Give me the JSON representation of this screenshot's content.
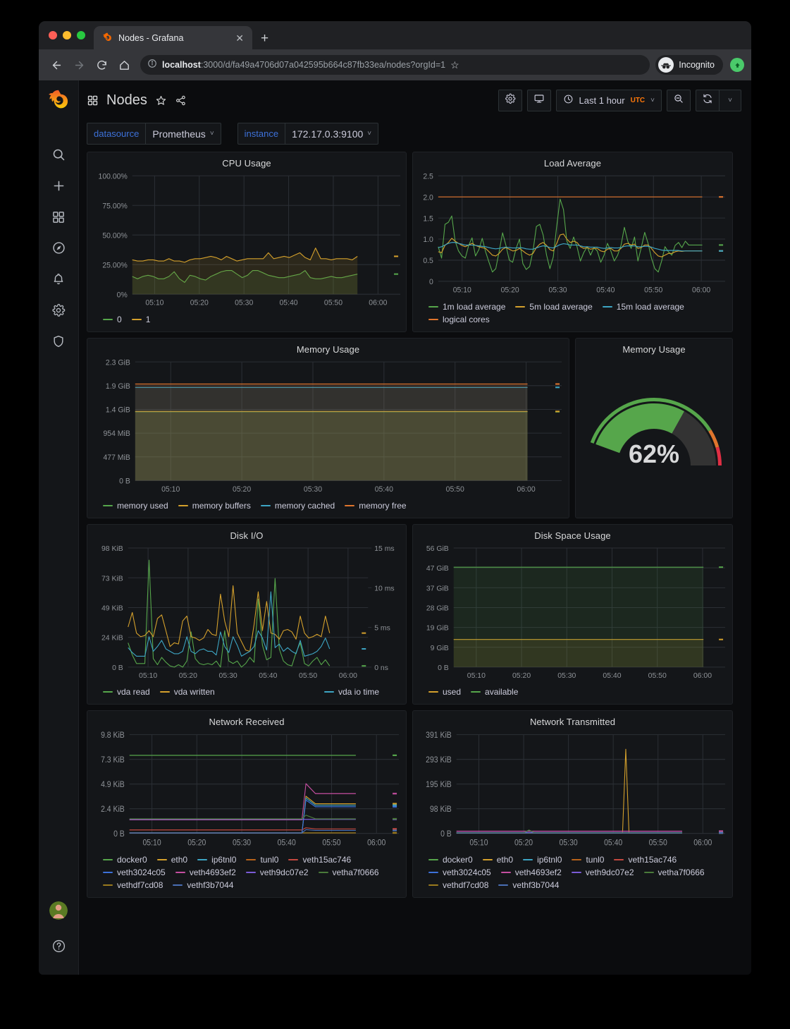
{
  "browser": {
    "tab": {
      "title": "Nodes - Grafana",
      "favicon": "grafana-logo-icon",
      "close": "✕"
    },
    "newtab_label": "+",
    "nav": {
      "back": "←",
      "forward": "→",
      "reload": "↻",
      "home": "⌂"
    },
    "omnibox": {
      "info_icon": "info-circle-icon",
      "url_bold": "localhost",
      "url_rest": ":3000/d/fa49a4706d07a042595b664c87fb33ea/nodes?orgId=1",
      "star_icon": "☆"
    },
    "profile": {
      "label": "Incognito",
      "icon": "incognito-icon"
    },
    "update_icon": "update-arrow-icon"
  },
  "sidenav": {
    "logo": "grafana-logo-icon",
    "items": [
      {
        "name": "search",
        "icon": "search-icon"
      },
      {
        "name": "create",
        "icon": "plus-icon"
      },
      {
        "name": "dashboards",
        "icon": "apps-grid-icon"
      },
      {
        "name": "explore",
        "icon": "compass-icon"
      },
      {
        "name": "alerting",
        "icon": "bell-icon"
      },
      {
        "name": "configuration",
        "icon": "gear-icon"
      },
      {
        "name": "server-admin",
        "icon": "shield-icon"
      }
    ],
    "avatar": "user-avatar",
    "help": "?"
  },
  "header": {
    "dashboards_icon": "apps-grid-icon",
    "title": "Nodes",
    "star_icon": "☆",
    "share_icon": "share-icon",
    "settings_icon": "gear-icon",
    "tv_icon": "tv-monitor-icon",
    "time_range": "Last 1 hour",
    "timezone": "UTC",
    "clock_icon": "clock-icon",
    "time_caret": "˅",
    "zoom_out_icon": "zoom-out-icon",
    "refresh_icon": "refresh-icon",
    "refresh_caret": "˅"
  },
  "variables": [
    {
      "label": "datasource",
      "value": "Prometheus",
      "caret": "˅"
    },
    {
      "label": "instance",
      "value": "172.17.0.3:9100",
      "caret": "˅"
    }
  ],
  "chart_data": [
    {
      "id": "cpu",
      "type": "area",
      "title": "CPU Usage",
      "xlabel": "",
      "ylabel": "",
      "ylim": [
        0,
        100
      ],
      "yticks": [
        "0%",
        "25.00%",
        "50.00%",
        "75.00%",
        "100.00%"
      ],
      "xticks": [
        "05:10",
        "05:20",
        "05:30",
        "05:40",
        "05:50",
        "06:00"
      ],
      "grid": true,
      "legend_position": "bottom",
      "series": [
        {
          "name": "0",
          "color": "#56a64b",
          "values": [
            15,
            13,
            15,
            16,
            15,
            13,
            13,
            15,
            19,
            13,
            10,
            16,
            15,
            13,
            12,
            15,
            17,
            19,
            20,
            20,
            17,
            14,
            16,
            20,
            20,
            18,
            16,
            15,
            14,
            14,
            15,
            16,
            17,
            20,
            14,
            13,
            13,
            14,
            15,
            14,
            14,
            15,
            16,
            17
          ]
        },
        {
          "name": "1",
          "color": "#d4a02c",
          "values": [
            29,
            28,
            28,
            29,
            29,
            28,
            28,
            30,
            28,
            28,
            27,
            29,
            30,
            30,
            31,
            32,
            31,
            29,
            32,
            30,
            28,
            29,
            30,
            30,
            30,
            30,
            35,
            30,
            31,
            32,
            31,
            33,
            35,
            31,
            29,
            39,
            30,
            30,
            29,
            30,
            30,
            30,
            29,
            32
          ]
        }
      ]
    },
    {
      "id": "load",
      "type": "line",
      "title": "Load Average",
      "ylim": [
        0,
        2.5
      ],
      "yticks": [
        "0",
        "0.5",
        "1.0",
        "1.5",
        "2.0",
        "2.5"
      ],
      "xticks": [
        "05:10",
        "05:20",
        "05:30",
        "05:40",
        "05:50",
        "06:00"
      ],
      "grid": true,
      "legend_position": "bottom",
      "series": [
        {
          "name": "1m load average",
          "color": "#56a64b",
          "values": [
            0.82,
            0.55,
            1.35,
            1.4,
            1.55,
            0.95,
            0.72,
            0.6,
            0.55,
            0.85,
            1.03,
            0.6,
            0.75,
            1.02,
            0.7,
            0.45,
            0.22,
            0.3,
            0.7,
            1.15,
            0.85,
            0.5,
            0.45,
            0.78,
            1.0,
            0.42,
            0.28,
            0.35,
            0.72,
            1.3,
            1.35,
            1.1,
            0.62,
            0.3,
            0.58,
            1.3,
            1.95,
            1.7,
            0.95,
            0.78,
            1.05,
            0.82,
            0.48,
            0.68,
            0.82,
            0.62,
            0.8,
            0.72,
            0.45,
            0.62,
            0.9,
            0.72,
            0.48,
            0.62,
            0.85,
            1.28,
            0.95,
            0.78,
            1.05,
            0.48,
            0.8,
            1.16,
            0.9,
            0.55,
            0.3,
            0.22,
            0.48,
            0.82,
            0.7,
            0.62,
            0.85,
            0.92,
            0.8,
            0.95,
            0.86,
            0.86,
            0.86,
            0.86,
            0.86
          ]
        },
        {
          "name": "5m load average",
          "color": "#d4a02c",
          "values": [
            0.7,
            0.68,
            0.85,
            0.92,
            1.02,
            0.95,
            0.9,
            0.85,
            0.82,
            0.86,
            0.9,
            0.85,
            0.82,
            0.8,
            0.78,
            0.7,
            0.62,
            0.6,
            0.66,
            0.76,
            0.8,
            0.76,
            0.72,
            0.73,
            0.78,
            0.72,
            0.66,
            0.62,
            0.66,
            0.8,
            0.88,
            0.92,
            0.85,
            0.75,
            0.72,
            0.9,
            1.1,
            1.12,
            1.0,
            0.92,
            0.95,
            0.92,
            0.82,
            0.78,
            0.8,
            0.76,
            0.78,
            0.78,
            0.72,
            0.7,
            0.76,
            0.78,
            0.72,
            0.72,
            0.78,
            0.88,
            0.9,
            0.86,
            0.88,
            0.78,
            0.8,
            0.86,
            0.86,
            0.78,
            0.68,
            0.6,
            0.58,
            0.62,
            0.66,
            0.66,
            0.7,
            0.72,
            0.71,
            0.72,
            0.72,
            0.72,
            0.72,
            0.72,
            0.72
          ]
        },
        {
          "name": "15m load average",
          "color": "#3da5c4",
          "values": [
            0.8,
            0.82,
            0.86,
            0.9,
            0.92,
            0.92,
            0.9,
            0.88,
            0.86,
            0.86,
            0.86,
            0.85,
            0.84,
            0.83,
            0.82,
            0.8,
            0.78,
            0.77,
            0.78,
            0.8,
            0.81,
            0.8,
            0.79,
            0.79,
            0.8,
            0.79,
            0.77,
            0.76,
            0.76,
            0.79,
            0.82,
            0.84,
            0.83,
            0.8,
            0.79,
            0.83,
            0.87,
            0.89,
            0.88,
            0.86,
            0.86,
            0.86,
            0.84,
            0.82,
            0.82,
            0.81,
            0.81,
            0.81,
            0.79,
            0.78,
            0.79,
            0.8,
            0.79,
            0.79,
            0.8,
            0.83,
            0.84,
            0.84,
            0.84,
            0.82,
            0.82,
            0.83,
            0.83,
            0.81,
            0.78,
            0.76,
            0.74,
            0.73,
            0.73,
            0.73,
            0.73,
            0.73,
            0.72,
            0.72,
            0.72,
            0.72,
            0.72,
            0.72,
            0.72
          ]
        },
        {
          "name": "logical cores",
          "color": "#e0752d",
          "constant": 2.0
        }
      ]
    },
    {
      "id": "memory",
      "type": "area",
      "title": "Memory Usage",
      "ylim": [
        0,
        2470
      ],
      "yticks": [
        "0 B",
        "477 MiB",
        "954 MiB",
        "1.4 GiB",
        "1.9 GiB",
        "2.3 GiB"
      ],
      "xticks": [
        "05:10",
        "05:20",
        "05:30",
        "05:40",
        "05:50",
        "06:00"
      ],
      "grid": true,
      "legend_position": "bottom",
      "series": [
        {
          "name": "memory used",
          "color": "#56a64b",
          "constant": 1433
        },
        {
          "name": "memory buffers",
          "color": "#d4a02c",
          "constant": 1440
        },
        {
          "name": "memory cached",
          "color": "#3da5c4",
          "constant": 1940
        },
        {
          "name": "memory free",
          "color": "#e0752d",
          "constant": 2010
        }
      ]
    },
    {
      "id": "memory_gauge",
      "type": "gauge",
      "title": "Memory Usage",
      "value": 62,
      "unit": "%",
      "min": 0,
      "max": 100,
      "display": "62%",
      "thresholds": [
        {
          "at": 0,
          "color": "#56a64b"
        },
        {
          "at": 80,
          "color": "#e0752d"
        },
        {
          "at": 90,
          "color": "#e02f44"
        }
      ]
    },
    {
      "id": "diskio",
      "type": "line",
      "title": "Disk I/O",
      "ylim": [
        0,
        98
      ],
      "yticks": [
        "0 B",
        "24 KiB",
        "49 KiB",
        "73 KiB",
        "98 KiB"
      ],
      "y2ticks": [
        "0 ns",
        "5 ms",
        "10 ms",
        "15 ms"
      ],
      "y2lim": [
        0,
        15
      ],
      "xticks": [
        "05:10",
        "05:20",
        "05:30",
        "05:40",
        "05:50",
        "06:00"
      ],
      "grid": true,
      "legend_position": "bottom",
      "series": [
        {
          "name": "vda read",
          "color": "#56a64b",
          "values": [
            20,
            10,
            3,
            3,
            3,
            88,
            7,
            2,
            8,
            4,
            1,
            0,
            2,
            0,
            5,
            29,
            7,
            3,
            2,
            3,
            2,
            5,
            0,
            30,
            5,
            3,
            5,
            0,
            3,
            8,
            4,
            56,
            18,
            6,
            8,
            73,
            15,
            5,
            2,
            1,
            12,
            20,
            3,
            1,
            5,
            8,
            2,
            6,
            1
          ]
        },
        {
          "name": "vda written",
          "color": "#d4a02c",
          "values": [
            33,
            45,
            28,
            25,
            26,
            30,
            25,
            40,
            43,
            30,
            17,
            20,
            19,
            38,
            42,
            25,
            24,
            22,
            24,
            31,
            27,
            26,
            60,
            38,
            25,
            67,
            28,
            21,
            14,
            13,
            35,
            62,
            30,
            54,
            28,
            27,
            23,
            30,
            31,
            29,
            23,
            42,
            28,
            24,
            25,
            27,
            25,
            42,
            28
          ]
        },
        {
          "name": "vda io time",
          "color": "#3da5c4",
          "values": [
            16,
            12,
            9,
            9,
            9,
            25,
            13,
            17,
            22,
            15,
            13,
            11,
            11,
            13,
            25,
            13,
            11,
            14,
            15,
            13,
            13,
            10,
            29,
            17,
            12,
            25,
            18,
            9,
            11,
            13,
            17,
            30,
            24,
            14,
            62,
            16,
            19,
            13,
            16,
            13,
            11,
            22,
            9,
            10,
            11,
            13,
            17,
            24,
            15
          ]
        }
      ]
    },
    {
      "id": "diskspace",
      "type": "area",
      "title": "Disk Space Usage",
      "ylim": [
        0,
        56
      ],
      "yticks": [
        "0 B",
        "9 GiB",
        "19 GiB",
        "28 GiB",
        "37 GiB",
        "47 GiB",
        "56 GiB"
      ],
      "xticks": [
        "05:10",
        "05:20",
        "05:30",
        "05:40",
        "05:50",
        "06:00"
      ],
      "grid": true,
      "legend_position": "bottom",
      "series": [
        {
          "name": "used",
          "color": "#d4a02c",
          "constant": 13.0
        },
        {
          "name": "available",
          "color": "#56a64b",
          "constant": 47.0
        }
      ]
    },
    {
      "id": "netrx",
      "type": "line",
      "title": "Network Received",
      "ylim": [
        0,
        9.8
      ],
      "yticks": [
        "0 B",
        "2.4 KiB",
        "4.9 KiB",
        "7.3 KiB",
        "9.8 KiB"
      ],
      "xticks": [
        "05:10",
        "05:20",
        "05:30",
        "05:40",
        "05:50",
        "06:00"
      ],
      "grid": true,
      "legend_position": "bottom",
      "series": [
        {
          "name": "docker0",
          "color": "#56a64b",
          "constant": 7.75
        },
        {
          "name": "eth0",
          "color": "#d4a02c",
          "step": {
            "before": 0.05,
            "after": 2.95,
            "at": 0.64
          }
        },
        {
          "name": "ip6tnl0",
          "color": "#3da5c4",
          "step": {
            "before": 0.05,
            "after": 2.8,
            "at": 0.64
          }
        },
        {
          "name": "tunl0",
          "color": "#b8631a",
          "constant": 0.05
        },
        {
          "name": "veth15ac746",
          "color": "#c4483f",
          "step": {
            "before": 0.35,
            "after": 0.45,
            "at": 0.64
          }
        },
        {
          "name": "veth3024c05",
          "color": "#3d71d9",
          "step": {
            "before": 0.05,
            "after": 2.65,
            "at": 0.64
          }
        },
        {
          "name": "veth4693ef2",
          "color": "#c44ea0",
          "step": {
            "before": 1.35,
            "after": 3.95,
            "at": 0.64
          }
        },
        {
          "name": "veth9dc07e2",
          "color": "#7b5bd6",
          "constant": 1.4
        },
        {
          "name": "vetha7f0666",
          "color": "#4a7a3a",
          "step": {
            "before": 1.45,
            "after": 1.45,
            "at": 0.64
          }
        },
        {
          "name": "vethdf7cd08",
          "color": "#9a7a1e",
          "constant": 0.06
        },
        {
          "name": "vethf3b7044",
          "color": "#4a6fb5",
          "step": {
            "before": 0.06,
            "after": 0.3,
            "at": 0.64
          }
        }
      ]
    },
    {
      "id": "nettx",
      "type": "line",
      "title": "Network Transmitted",
      "ylim": [
        0,
        391
      ],
      "yticks": [
        "0 B",
        "98 KiB",
        "195 KiB",
        "293 KiB",
        "391 KiB"
      ],
      "xticks": [
        "05:10",
        "05:20",
        "05:30",
        "05:40",
        "05:50",
        "06:00"
      ],
      "grid": true,
      "legend_position": "bottom",
      "series": [
        {
          "name": "docker0",
          "color": "#56a64b",
          "constant": 2
        },
        {
          "name": "eth0",
          "color": "#d4a02c",
          "spike": {
            "at": 0.63,
            "peak": 333,
            "base": 2
          }
        },
        {
          "name": "ip6tnl0",
          "color": "#3da5c4",
          "constant": 2
        },
        {
          "name": "tunl0",
          "color": "#b8631a",
          "constant": 2
        },
        {
          "name": "veth15ac746",
          "color": "#c4483f",
          "constant": 3
        },
        {
          "name": "veth3024c05",
          "color": "#3d71d9",
          "bump": {
            "at": 0.27,
            "peak": 12,
            "base": 2
          }
        },
        {
          "name": "veth4693ef2",
          "color": "#c44ea0",
          "constant": 9
        },
        {
          "name": "veth9dc07e2",
          "color": "#7b5bd6",
          "constant": 4
        },
        {
          "name": "vetha7f0666",
          "color": "#4a7a3a",
          "bump": {
            "at": 0.27,
            "peak": 14,
            "base": 3
          }
        },
        {
          "name": "vethdf7cd08",
          "color": "#9a7a1e",
          "constant": 2
        },
        {
          "name": "vethf3b7044",
          "color": "#4a6fb5",
          "constant": 2
        }
      ]
    }
  ]
}
